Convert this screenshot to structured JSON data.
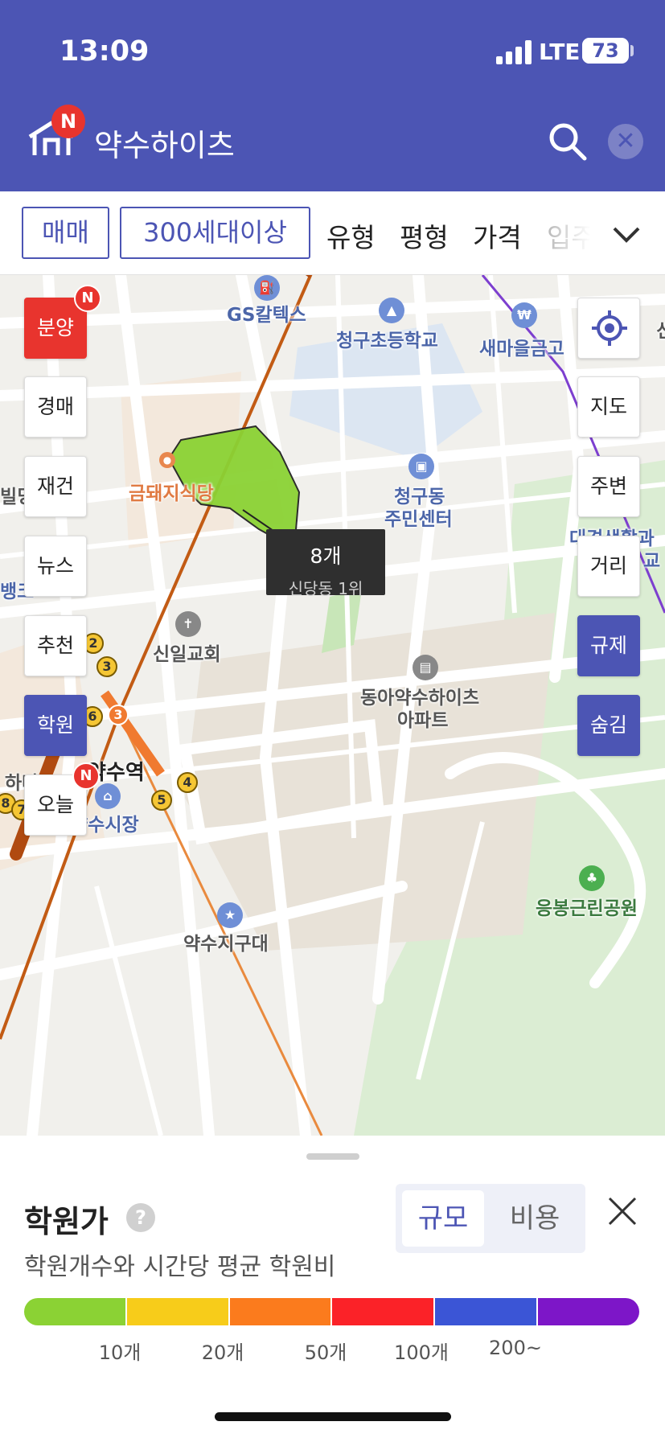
{
  "status_bar": {
    "time": "13:09",
    "network": "LTE",
    "battery": "73",
    "battery_level": 0.73
  },
  "header": {
    "logo_badge": "N",
    "title": "약수하이츠"
  },
  "filters": {
    "chip_sale": "매매",
    "chip_households": "300세대이상",
    "type": "유형",
    "area": "평형",
    "price": "가격",
    "more_partial": "입주"
  },
  "map": {
    "labels": {
      "gs": "GS칼텍스",
      "school": "청구초등학교",
      "bank": "새마을금고",
      "left_partial": "빌딩",
      "church_store": "금돼지식당",
      "district": "청구동",
      "center": "주민센터",
      "welfare": "대경생활과",
      "welfare2": "교",
      "church": "신일교회",
      "apartment": "동아약수하이츠",
      "apartment2": "아파트",
      "left_bank": "뱅크",
      "left_hana": "하나",
      "station": "약수역",
      "market": "약수시장",
      "police": "약수지구대",
      "park": "응봉근린공원",
      "right_partial": "신"
    },
    "station_exits": [
      "2",
      "3",
      "6",
      "3",
      "4",
      "5",
      "8",
      "7"
    ],
    "highlight_area": {
      "count": "8개",
      "rank": "신당동 1위"
    }
  },
  "left_buttons": [
    {
      "label": "분양",
      "badge": "N"
    },
    {
      "label": "경매"
    },
    {
      "label": "재건"
    },
    {
      "label": "뉴스"
    },
    {
      "label": "추천"
    },
    {
      "label": "학원"
    },
    {
      "label": "오늘",
      "badge": "N"
    }
  ],
  "right_buttons": [
    "지도",
    "주변",
    "거리",
    "규제",
    "숨김"
  ],
  "bottom_sheet": {
    "title": "학원가",
    "help": "?",
    "toggle": {
      "size": "규모",
      "cost": "비용"
    },
    "description": "학원개수와 시간당 평균 학원비",
    "legend_colors": [
      "#8bd234",
      "#f7cc1a",
      "#fb7b1d",
      "#fb2228",
      "#3b55d6",
      "#7d16c8"
    ],
    "legend_labels": [
      "10개",
      "20개",
      "50개",
      "100개",
      "200~"
    ]
  },
  "colors": {
    "brand": "#4c55b4",
    "alert": "#e8342e",
    "highlight_area": "#8bd234"
  }
}
